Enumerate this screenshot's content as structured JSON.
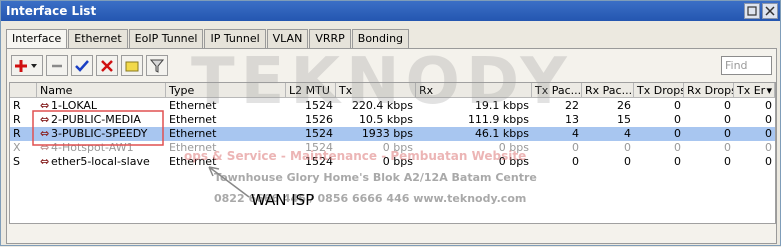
{
  "window": {
    "title": "Interface List"
  },
  "tabs": [
    "Interface",
    "Ethernet",
    "EoIP Tunnel",
    "IP Tunnel",
    "VLAN",
    "VRRP",
    "Bonding"
  ],
  "toolbar": {
    "find_placeholder": "Find"
  },
  "columns": {
    "flag": "",
    "name": "Name",
    "type": "Type",
    "l2mtu": "L2 MTU",
    "tx": "Tx",
    "rx": "Rx",
    "tx_packets": "Tx Pac...",
    "rx_packets": "Rx Pac...",
    "tx_drops": "Tx Drops",
    "rx_drops": "Rx Drops",
    "tx_errors": "Tx Er"
  },
  "rows": [
    {
      "flag": "R",
      "name": "1-LOKAL",
      "type": "Ethernet",
      "l2mtu": "1524",
      "tx": "220.4 kbps",
      "rx": "19.1 kbps",
      "tx_packets": "22",
      "rx_packets": "26",
      "tx_drops": "0",
      "rx_drops": "0",
      "tx_errors": "0"
    },
    {
      "flag": "R",
      "name": "2-PUBLIC-MEDIA",
      "type": "Ethernet",
      "l2mtu": "1526",
      "tx": "10.5 kbps",
      "rx": "111.9 kbps",
      "tx_packets": "13",
      "rx_packets": "15",
      "tx_drops": "0",
      "rx_drops": "0",
      "tx_errors": "0"
    },
    {
      "flag": "R",
      "name": "3-PUBLIC-SPEEDY",
      "type": "Ethernet",
      "l2mtu": "1524",
      "tx": "1933 bps",
      "rx": "46.1 kbps",
      "tx_packets": "4",
      "rx_packets": "4",
      "tx_drops": "0",
      "rx_drops": "0",
      "tx_errors": "0"
    },
    {
      "flag": "X",
      "name": "4-Hotspot-AW1",
      "type": "Ethernet",
      "l2mtu": "1524",
      "tx": "0 bps",
      "rx": "0 bps",
      "tx_packets": "0",
      "rx_packets": "0",
      "tx_drops": "0",
      "rx_drops": "0",
      "tx_errors": "0"
    },
    {
      "flag": "S",
      "name": "ether5-local-slave",
      "type": "Ethernet",
      "l2mtu": "1524",
      "tx": "0 bps",
      "rx": "0 bps",
      "tx_packets": "0",
      "rx_packets": "0",
      "tx_drops": "0",
      "rx_drops": "0",
      "tx_errors": "0"
    }
  ],
  "watermark": {
    "brand": "TEKNODY",
    "line1": "ops & Service - Maintenance - Pembuatan Website",
    "line2": "Townhouse Glory Home's Blok A2/12A Batam Centre",
    "line3": "0822 6666 446 / 0856 6666 446   www.teknody.com"
  },
  "annotation": {
    "label": "WAN ISP"
  },
  "colors": {
    "selected_row": "#a8c6f0",
    "annotation_box": "#e05050",
    "titlebar": "#2456b0"
  }
}
